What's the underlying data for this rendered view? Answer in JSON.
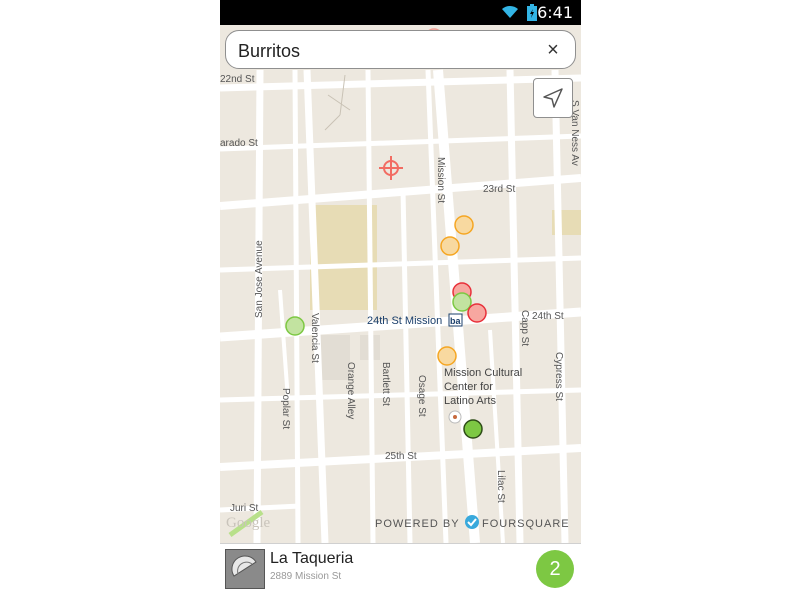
{
  "status_bar": {
    "time": "6:41",
    "wifi_icon": "wifi-icon",
    "battery_icon": "battery-icon"
  },
  "search": {
    "query": "Burritos",
    "clear_icon": "close-icon",
    "clear_glyph": "×"
  },
  "locate_button": {
    "icon": "navigation-arrow-icon"
  },
  "map": {
    "streets": {
      "s22nd": "22nd St",
      "lexington": "arado St",
      "s23rd": "23rd St",
      "s24th": "24th St",
      "s25th": "25th St",
      "mission": "Mission St",
      "valencia": "Valencia St",
      "san_jose": "San Jose Avenue",
      "orange": "Orange Alley",
      "bartlett": "Bartlett St",
      "osage": "Osage St",
      "poplar": "Poplar St",
      "capp": "Capp St",
      "cypress": "Cypress St",
      "lilac": "Lilac St",
      "juri": "Juri St",
      "van_ness": "S Van Ness Av"
    },
    "bart_station": "24th St Mission",
    "bart_badge": "ba",
    "landmark": [
      "Mission Cultural",
      "Center for",
      "Latino Arts"
    ],
    "google_logo": "Google",
    "powered_by": "POWERED BY",
    "foursquare": "FOURSQUARE",
    "pin_colors": {
      "green": "#7dc843",
      "orange": "#f5a623",
      "red": "#e8303a",
      "target": "#f26c62"
    }
  },
  "selected_venue": {
    "name": "La Taqueria",
    "address": "2889 Mission St",
    "count": "2",
    "thumb_icon": "taco-icon"
  }
}
